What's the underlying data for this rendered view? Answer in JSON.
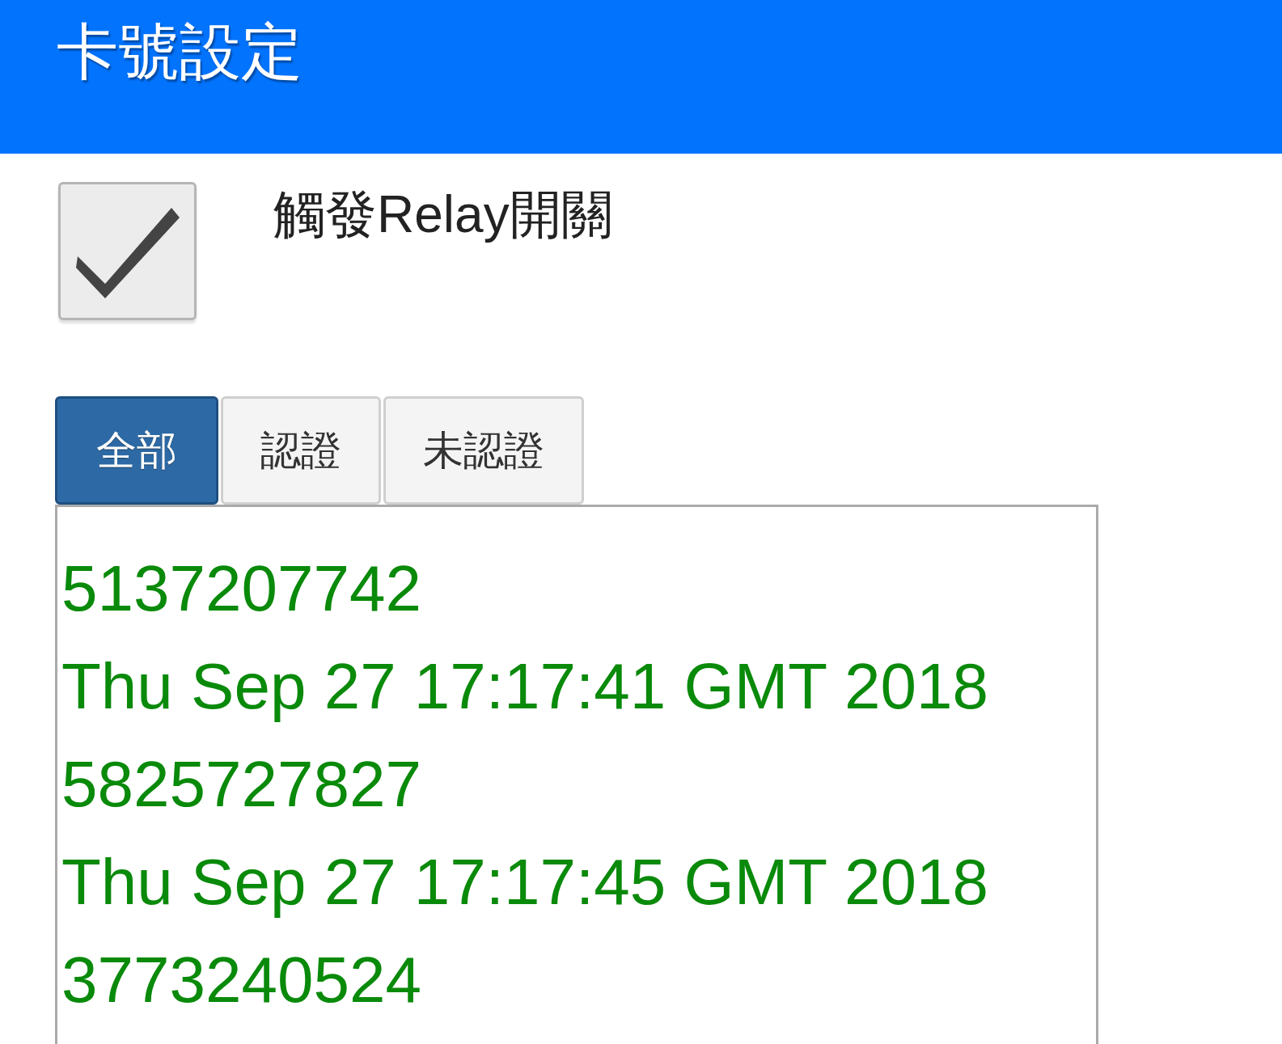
{
  "header": {
    "title": "卡號設定"
  },
  "relay_toggle": {
    "label": "觸發Relay開關",
    "checked": true
  },
  "tabs": [
    {
      "label": "全部",
      "selected": true
    },
    {
      "label": "認證",
      "selected": false
    },
    {
      "label": "未認證",
      "selected": false
    }
  ],
  "log_lines": [
    "5137207742",
    "Thu Sep 27 17:17:41 GMT 2018",
    "5825727827",
    "Thu Sep 27 17:17:45 GMT 2018",
    "3773240524"
  ]
}
